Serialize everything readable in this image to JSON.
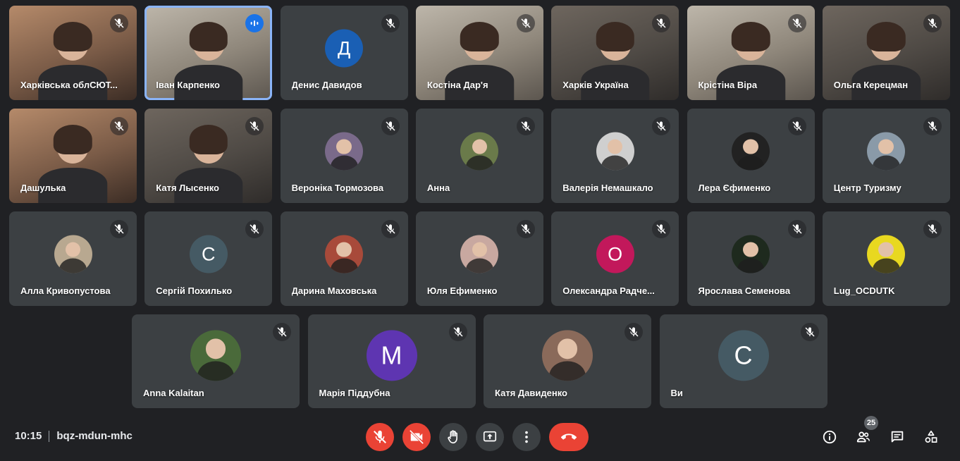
{
  "meeting": {
    "time": "10:15",
    "code": "bqz-mdun-mhc",
    "participants_count": "25"
  },
  "colors": {
    "background": "#202124",
    "tile": "#3c4043",
    "danger": "#ea4335",
    "speaking": "#8ab4f8",
    "button": "#3c4043"
  },
  "participants": [
    {
      "name": "Харківська облСЮТ...",
      "type": "video",
      "tone": "warm",
      "muted": true
    },
    {
      "name": "Іван Карпенко",
      "type": "video",
      "tone": "light",
      "muted": false,
      "speaking": true
    },
    {
      "name": "Денис Давидов",
      "type": "initial",
      "initial": "Д",
      "color": "#1a5fb4",
      "muted": true
    },
    {
      "name": "Костіна Дар'я",
      "type": "video",
      "tone": "light",
      "muted": true
    },
    {
      "name": "Харків Україна",
      "type": "video",
      "tone": "dark",
      "muted": true
    },
    {
      "name": "Крістіна Віра",
      "type": "video",
      "tone": "light",
      "muted": true
    },
    {
      "name": "Ольга Керецман",
      "type": "video",
      "tone": "dark",
      "muted": true
    },
    {
      "name": "Дашулька",
      "type": "video",
      "tone": "warm",
      "muted": true
    },
    {
      "name": "Катя Лысенко",
      "type": "video",
      "tone": "dark",
      "muted": true
    },
    {
      "name": "Вероніка Тормозова",
      "type": "photo",
      "color": "#7a6a8a",
      "muted": true
    },
    {
      "name": "Анна",
      "type": "photo",
      "color": "#6a7a4a",
      "muted": true
    },
    {
      "name": "Валерія Немашкало",
      "type": "photo",
      "color": "#cfcfcf",
      "muted": true
    },
    {
      "name": "Лера Єфименко",
      "type": "photo",
      "color": "#222222",
      "muted": true
    },
    {
      "name": "Центр Туризму",
      "type": "photo",
      "color": "#8a9aa8",
      "muted": true
    },
    {
      "name": "Алла Кривопустова",
      "type": "photo",
      "color": "#b8a890",
      "muted": true
    },
    {
      "name": "Сергій Похилько",
      "type": "initial",
      "initial": "С",
      "color": "#455a64",
      "muted": true
    },
    {
      "name": "Дарина Маховська",
      "type": "photo",
      "color": "#a84a3a",
      "muted": true
    },
    {
      "name": "Юля Ефименко",
      "type": "photo",
      "color": "#c8a8a0",
      "muted": true
    },
    {
      "name": "Олександра Радче...",
      "type": "initial",
      "initial": "О",
      "color": "#c2185b",
      "muted": true
    },
    {
      "name": "Ярослава Семенова",
      "type": "photo",
      "color": "#1e2a1e",
      "muted": true
    },
    {
      "name": "Lug_OCDUTK",
      "type": "photo",
      "color": "#e8d820",
      "muted": true
    },
    {
      "name": "Anna Kalaitan",
      "type": "photo",
      "color": "#4a6a3a",
      "muted": true
    },
    {
      "name": "Марія Піддубна",
      "type": "initial",
      "initial": "М",
      "color": "#5e35b1",
      "muted": true
    },
    {
      "name": "Катя Давиденко",
      "type": "photo",
      "color": "#8a6a5a",
      "muted": true
    },
    {
      "name": "Ви",
      "type": "initial",
      "initial": "С",
      "color": "#455a64",
      "muted": true
    }
  ],
  "controls": [
    {
      "name": "mic-toggle-button",
      "icon": "mic-off-icon",
      "color": "#ea4335"
    },
    {
      "name": "camera-toggle-button",
      "icon": "camera-off-icon",
      "color": "#ea4335"
    },
    {
      "name": "raise-hand-button",
      "icon": "hand-icon",
      "color": "#3c4043"
    },
    {
      "name": "present-button",
      "icon": "present-icon",
      "color": "#3c4043"
    },
    {
      "name": "more-options-button",
      "icon": "more-vert-icon",
      "color": "#3c4043"
    },
    {
      "name": "leave-call-button",
      "icon": "call-end-icon",
      "color": "#ea4335"
    }
  ],
  "right_controls": [
    {
      "name": "meeting-details-button",
      "icon": "info-icon"
    },
    {
      "name": "people-button",
      "icon": "people-icon"
    },
    {
      "name": "chat-button",
      "icon": "chat-icon"
    },
    {
      "name": "activities-button",
      "icon": "activities-icon"
    }
  ]
}
